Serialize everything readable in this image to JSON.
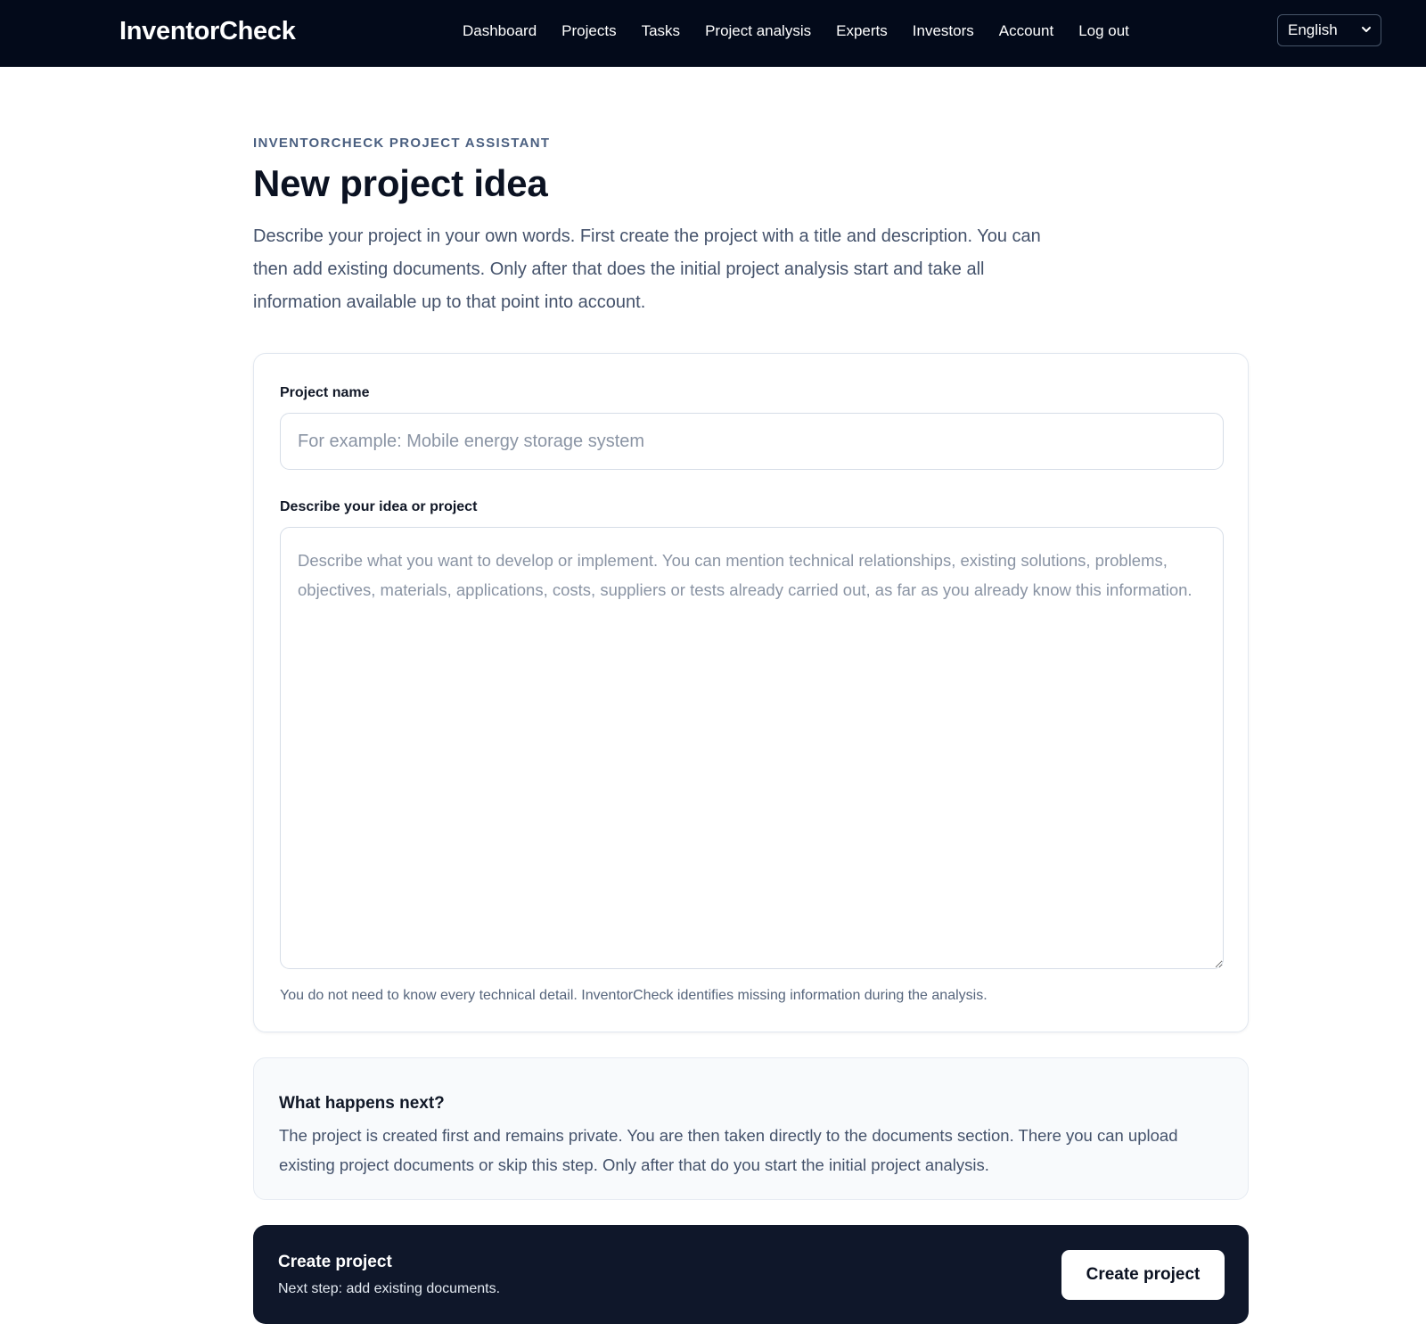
{
  "header": {
    "brand": "InventorCheck",
    "nav": [
      "Dashboard",
      "Projects",
      "Tasks",
      "Project analysis",
      "Experts",
      "Investors",
      "Account",
      "Log out"
    ],
    "language": "English"
  },
  "intro": {
    "eyebrow": "INVENTORCHECK PROJECT ASSISTANT",
    "title": "New project idea",
    "lead": "Describe your project in your own words. First create the project with a title and description. You can then add existing documents. Only after that does the initial project analysis start and take all information available up to that point into account."
  },
  "form": {
    "name_label": "Project name",
    "name_placeholder": "For example: Mobile energy storage system",
    "name_value": "",
    "desc_label": "Describe your idea or project",
    "desc_placeholder": "Describe what you want to develop or implement. You can mention technical relationships, existing solutions, problems, objectives, materials, applications, costs, suppliers or tests already carried out, as far as you already know this information.",
    "desc_value": "",
    "hint": "You do not need to know every technical detail. InventorCheck identifies missing information during the analysis."
  },
  "info": {
    "title": "What happens next?",
    "text": "The project is created first and remains private. You are then taken directly to the documents section. There you can upload existing project documents or skip this step. Only after that do you start the initial project analysis."
  },
  "cta": {
    "title": "Create project",
    "subtitle": "Next step: add existing documents.",
    "button": "Create project"
  }
}
